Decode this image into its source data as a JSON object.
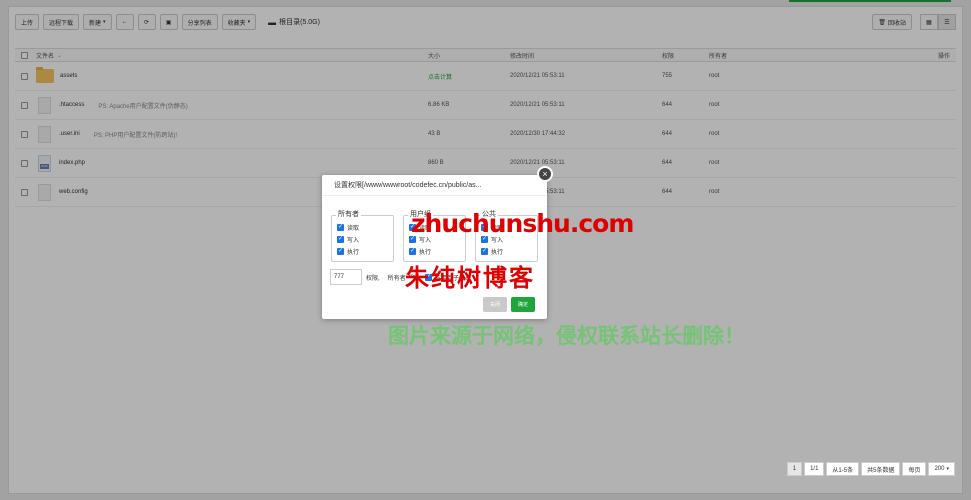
{
  "toolbar": {
    "upload_label": "上传",
    "remote_download_label": "远程下载",
    "new_label": "新建",
    "share_list_label": "分享列表",
    "favorites_label": "收藏夹",
    "breadcrumb": "根目录(5.0G)",
    "recycle_label": "回收站"
  },
  "table": {
    "headers": {
      "name": "文件名",
      "size": "大小",
      "modified": "修改时间",
      "permission": "权限",
      "owner": "所有者",
      "actions": "操作"
    },
    "rows": [
      {
        "name": "assets",
        "ps": "",
        "size": "点击计算",
        "time": "2020/12/21 05:53:11",
        "perm": "755",
        "owner": "root"
      },
      {
        "name": ".htaccess",
        "ps": "PS: Apache用户配置文件(伪静态)",
        "size": "6.86 KB",
        "time": "2020/12/21 05:53:11",
        "perm": "644",
        "owner": "root"
      },
      {
        "name": ".user.ini",
        "ps": "PS: PHP用户配置文件(防跨站)!",
        "size": "43 B",
        "time": "2020/12/30 17:44:32",
        "perm": "644",
        "owner": "root"
      },
      {
        "name": "index.php",
        "ps": "",
        "size": "860 B",
        "time": "2020/12/21 05:53:11",
        "perm": "644",
        "owner": "root"
      },
      {
        "name": "web.config",
        "ps": "",
        "size": "",
        "time": "2020/12/21 05:53:11",
        "perm": "644",
        "owner": "root"
      }
    ]
  },
  "pager": {
    "current": "1",
    "pages": "1/1",
    "range": "从1-5条",
    "total": "共5条数据",
    "per_page_label": "每页",
    "per_page_value": "200"
  },
  "modal": {
    "title": "设置权限[/www/wwwroot/codefec.cn/public/as...",
    "owner_group": {
      "legend": "所有者",
      "read": "读取",
      "write": "写入",
      "exec": "执行"
    },
    "user_group": {
      "legend": "用户组",
      "read": "读取",
      "write": "写入",
      "exec": "执行"
    },
    "public_group": {
      "legend": "公共",
      "read": "读取",
      "write": "写入",
      "exec": "执行"
    },
    "perm_value": "777",
    "perm_label": "权限,",
    "owner_label": "所有者",
    "owner_value": "root",
    "apply_sub": "应用到子目录",
    "cancel_label": "关闭",
    "confirm_label": "确定"
  },
  "watermark": {
    "site": "zhuchunshu.com",
    "blog": "朱纯树博客",
    "notice": "图片来源于网络，侵权联系站长删除！"
  },
  "colors": {
    "brand_green": "#20a53a",
    "checkbox_blue": "#1a73e8",
    "watermark_red": "#e00000"
  }
}
